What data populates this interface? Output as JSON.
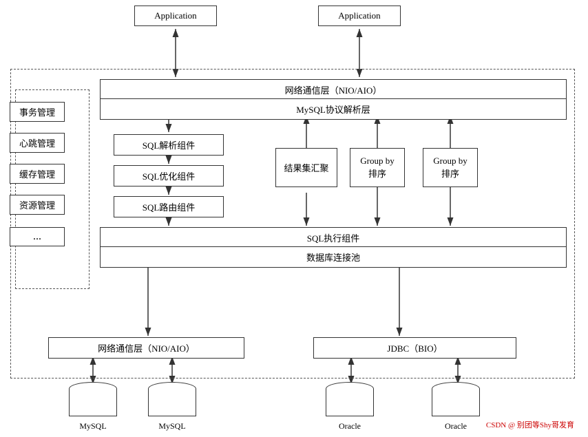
{
  "apps": {
    "left_label": "Application",
    "right_label": "Application"
  },
  "layers": {
    "network_top": "网络通信层（NIO/AIO）",
    "mysql_protocol": "MySQL协议解析层",
    "sql_parse": "SQL解析组件",
    "sql_optimize": "SQL优化组件",
    "sql_route": "SQL路由组件",
    "result_merge": "结果集汇聚",
    "group_by_1_line1": "Group by",
    "group_by_1_line2": "排序",
    "group_by_2_line1": "Group by",
    "group_by_2_line2": "排序",
    "sql_exec": "SQL执行组件",
    "db_pool": "数据库连接池",
    "bottom_network": "网络通信层（NIO/AIO）",
    "jdbc": "JDBC（BIO）"
  },
  "management": {
    "tx": "事务管理",
    "heartbeat": "心跳管理",
    "cache": "缓存管理",
    "resource": "资源管理",
    "more": "..."
  },
  "databases": {
    "mysql1": "MySQL",
    "mysql2": "MySQL",
    "oracle1": "Oracle",
    "oracle2": "Oracle"
  },
  "watermark": "CSDN @ 别团等Shy哥发育"
}
